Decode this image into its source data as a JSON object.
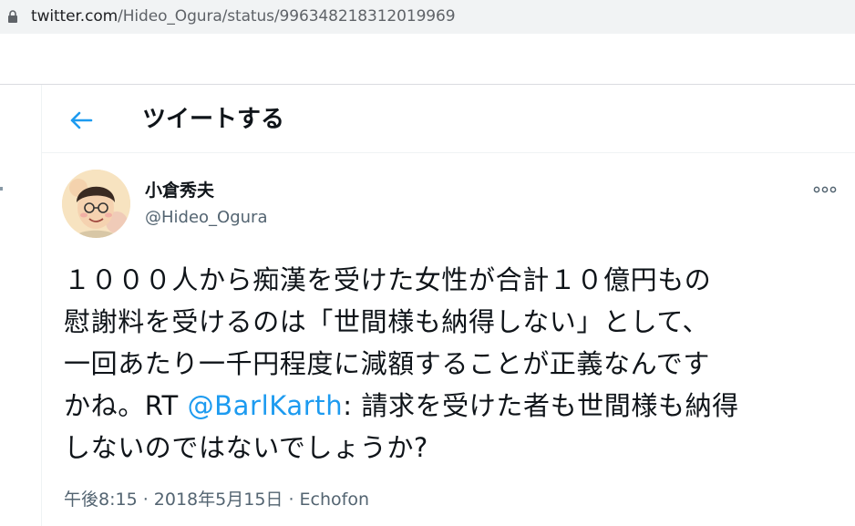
{
  "browser": {
    "url_host": "twitter.com",
    "url_path": "/Hideo_Ogura/status/996348218312019969"
  },
  "header": {
    "title": "ツイートする"
  },
  "tweet": {
    "author_name": "小倉秀夫",
    "author_handle": "@Hideo_Ogura",
    "lines": [
      "１０００人から痴漢を受けた女性が合計１０億円もの",
      "慰謝料を受けるのは「世間様も納得しない」として、",
      "一回あたり一千円程度に減額することが正義なんです",
      "かね。RT "
    ],
    "mention": "@BarlKarth",
    "after_mention": ": 請求を受けた者も世間様も納得",
    "last_line": "しないのではないでしょうか?",
    "time": "午後8:15",
    "date": "2018年5月15日",
    "separator": " · ",
    "source": "Echofon"
  },
  "icons": {
    "back": "arrow-left-icon",
    "more": "more-horizontal-icon",
    "lock": "lock-icon"
  },
  "colors": {
    "accent": "#1d9bf0",
    "secondary_text": "#536471"
  }
}
